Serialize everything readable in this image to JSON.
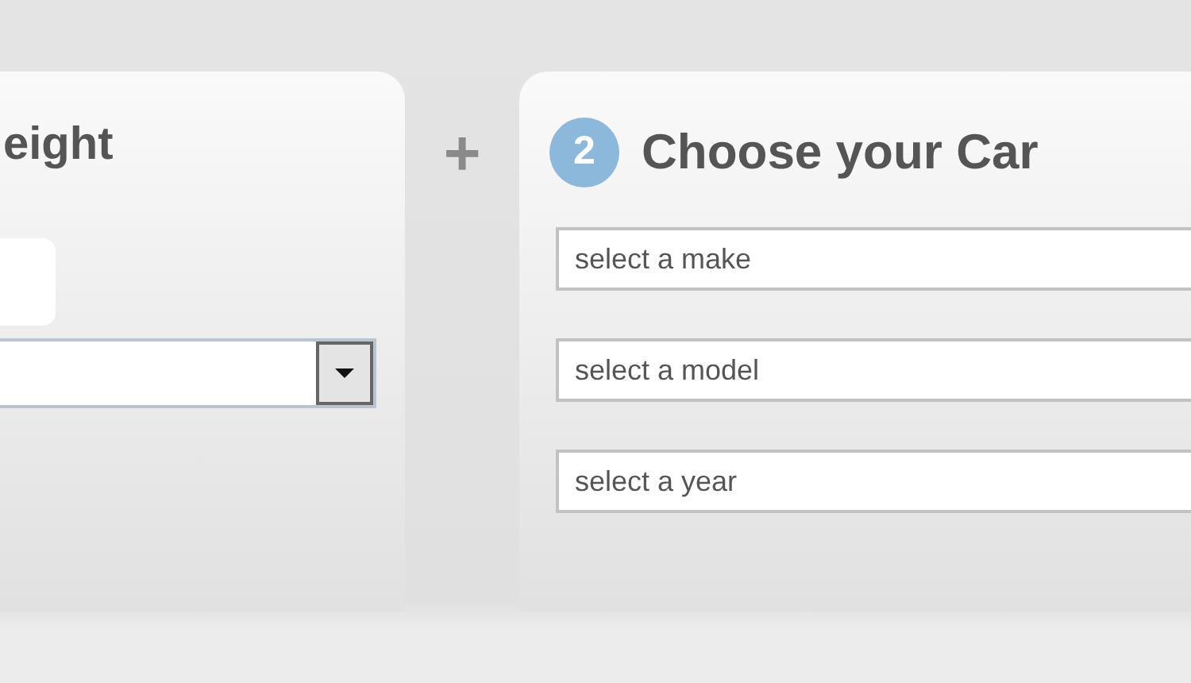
{
  "weight_panel": {
    "title": "eight",
    "fields": [
      {
        "kind": "box"
      },
      {
        "kind": "select"
      }
    ]
  },
  "joiner": "+",
  "car_panel": {
    "number": "2",
    "title": "Choose your Car",
    "fields": [
      {
        "kind": "input",
        "placeholder": "select a make"
      },
      {
        "kind": "input",
        "placeholder": "select a model"
      },
      {
        "kind": "input",
        "placeholder": "select a year"
      }
    ]
  }
}
